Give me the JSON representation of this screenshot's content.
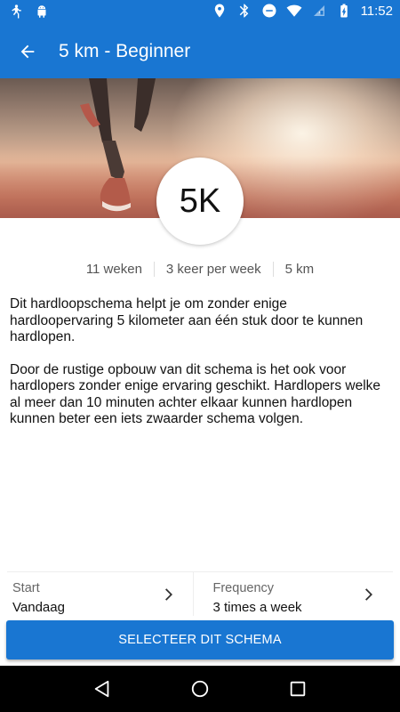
{
  "statusbar": {
    "time": "11:52",
    "left_icons": [
      "runner-app-icon",
      "android-icon"
    ],
    "right_icons": [
      "location-icon",
      "bluetooth-icon",
      "do-not-disturb-icon",
      "wifi-icon",
      "no-signal-icon",
      "battery-charging-icon"
    ]
  },
  "appbar": {
    "title": "5 km - Beginner",
    "back_icon": "arrow-back-icon",
    "color": "#1976d2"
  },
  "hero": {
    "badge_text": "5K"
  },
  "stats": [
    "11 weken",
    "3 keer per week",
    "5 km"
  ],
  "description": [
    "Dit hardloopschema helpt je om zonder enige hardloopervaring 5 kilometer aan één stuk door te kunnen hardlopen.",
    "Door de rustige opbouw van dit schema is het ook voor hardlopers zonder enige ervaring geschikt. Hardlopers welke al meer dan 10 minuten achter elkaar kunnen hardlopen kunnen beter een iets zwaarder schema volgen."
  ],
  "settings": {
    "start": {
      "label": "Start",
      "value": "Vandaag"
    },
    "frequency": {
      "label": "Frequency",
      "value": "3 times a week"
    }
  },
  "cta_label": "SELECTEER DIT SCHEMA",
  "navbar": [
    "back-nav-icon",
    "home-nav-icon",
    "recents-nav-icon"
  ]
}
